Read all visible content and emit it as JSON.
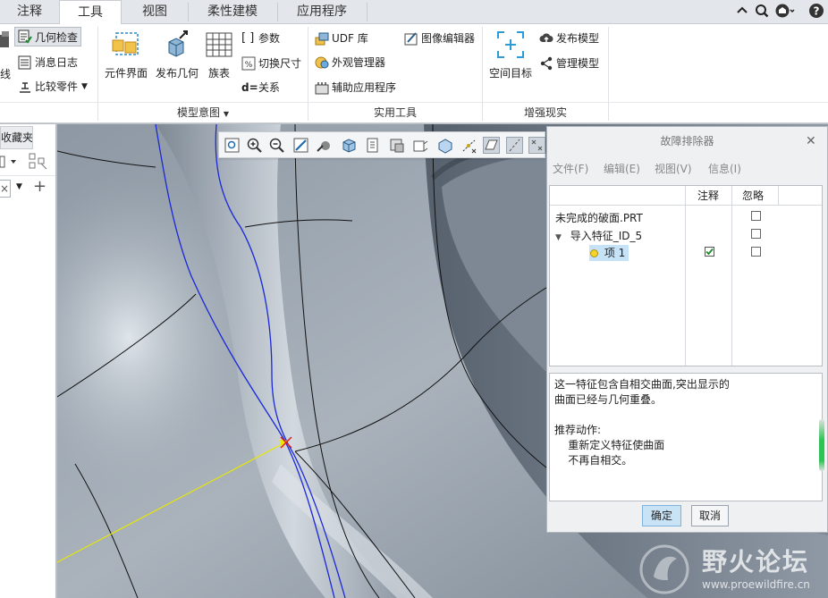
{
  "tabs": [
    {
      "label": "注释",
      "active": false
    },
    {
      "label": "工具",
      "active": true
    },
    {
      "label": "视图",
      "active": false
    },
    {
      "label": "柔性建模",
      "active": false
    },
    {
      "label": "应用程序",
      "active": false
    }
  ],
  "top_icons": [
    "chevron-up-icon",
    "search-icon",
    "help-center-icon",
    "help-icon"
  ],
  "ribbon": {
    "inv_group": {
      "cut_label": "线",
      "geometry_check": "几何检查",
      "message_log": "消息日志",
      "compare_parts": "比较零件"
    },
    "model_intent": {
      "component_interface": "元件界面",
      "publish_geometry": "发布几何",
      "family_table": "族表",
      "parameters": "参数",
      "switch_dimensions": "切换尺寸",
      "relations": "关系",
      "group_label": "模型意图"
    },
    "utilities": {
      "udf_library": "UDF 库",
      "appearance_manager": "外观管理器",
      "auxiliary_apps": "辅助应用程序",
      "image_editor": "图像编辑器",
      "group_label": "实用工具"
    },
    "ar": {
      "space_target": "空间目标",
      "publish_model": "发布模型",
      "manage_model": "管理模型",
      "group_label": "增强现实"
    }
  },
  "left_panel": {
    "tab_label": "收藏夹"
  },
  "troubleshooter": {
    "title": "故障排除器",
    "menus": [
      "文件(F)",
      "编辑(E)",
      "视图(V)",
      "信息(I)"
    ],
    "columns": {
      "note": "注释",
      "ignore": "忽略"
    },
    "rows": [
      {
        "label": "未完成的破面.PRT",
        "note": null,
        "ignore": false
      },
      {
        "label": "导入特征_ID_5",
        "note": null,
        "ignore": false
      },
      {
        "label": "项 1",
        "note": true,
        "ignore": false
      }
    ],
    "message": "这一特征包含自相交曲面,突出显示的\n曲面已经与几何重叠。\n\n推荐动作:\n    重新定义特征使曲面\n    不再自相交。",
    "ok_label": "确定",
    "cancel_label": "取消"
  },
  "watermark": {
    "title": "野火论坛",
    "url": "www.proewildfire.cn"
  },
  "colors": {
    "accent": "#2f7fc1",
    "selection": "#c6e2f7",
    "curve_blue": "#1a28d8",
    "curve_yellow": "#e8e800"
  }
}
